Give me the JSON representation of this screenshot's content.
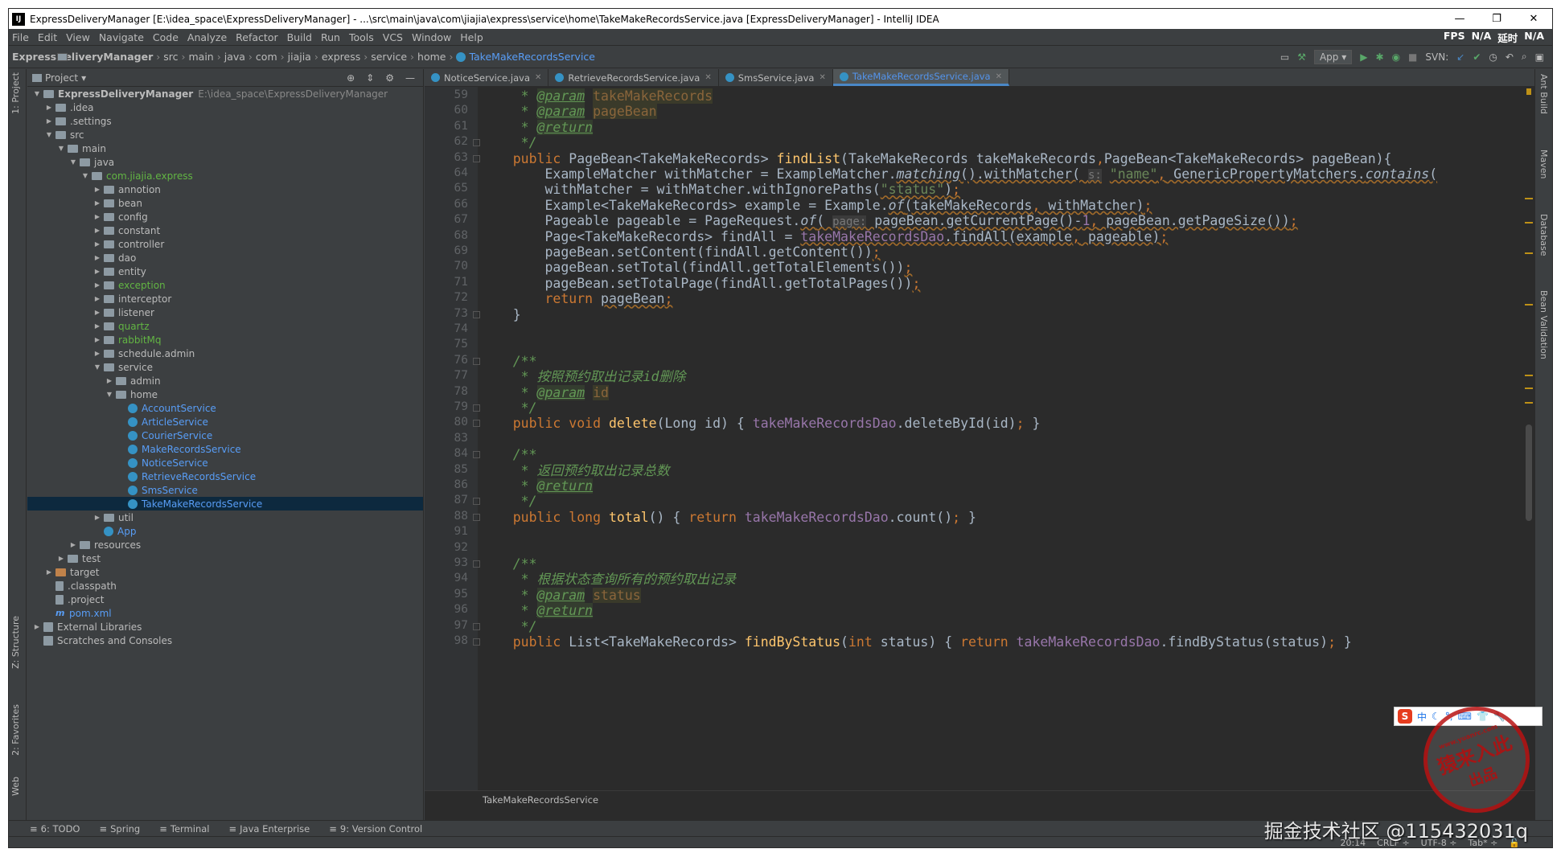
{
  "window": {
    "title": "ExpressDeliveryManager [E:\\idea_space\\ExpressDeliveryManager] - ...\\src\\main\\java\\com\\jiajia\\express\\service\\home\\TakeMakeRecordsService.java [ExpressDeliveryManager] - IntelliJ IDEA",
    "logo": "IJ",
    "minimize": "—",
    "restore": "❐",
    "close": "✕"
  },
  "menu": {
    "items": [
      "File",
      "Edit",
      "View",
      "Navigate",
      "Code",
      "Analyze",
      "Refactor",
      "Build",
      "Run",
      "Tools",
      "VCS",
      "Window",
      "Help"
    ],
    "fps_label": "FPS",
    "fps_value": "N/A",
    "latency_label": "延时",
    "latency_value": "N/A"
  },
  "breadcrumbs": [
    "ExpressDeliveryManager",
    "src",
    "main",
    "java",
    "com",
    "jiajia",
    "express",
    "service",
    "home",
    "TakeMakeRecordsService"
  ],
  "toolbar": {
    "run_config": "App",
    "svn_label": "SVN:"
  },
  "side_tabs": {
    "left": [
      "1: Project",
      "Z: Structure",
      "2: Favorites",
      "Web"
    ],
    "right": [
      "Ant Build",
      "Maven",
      "Database",
      "Bean Validation"
    ]
  },
  "project": {
    "title": "Project",
    "tree": [
      {
        "label": "ExpressDeliveryManager",
        "path": "E:\\idea_space\\ExpressDeliveryManager",
        "depth": 0,
        "arrow": "▼",
        "icon": "folder",
        "style": "bold"
      },
      {
        "label": ".idea",
        "depth": 1,
        "arrow": "▶",
        "icon": "folder"
      },
      {
        "label": ".settings",
        "depth": 1,
        "arrow": "▶",
        "icon": "folder"
      },
      {
        "label": "src",
        "depth": 1,
        "arrow": "▼",
        "icon": "folder"
      },
      {
        "label": "main",
        "depth": 2,
        "arrow": "▼",
        "icon": "folder"
      },
      {
        "label": "java",
        "depth": 3,
        "arrow": "▼",
        "icon": "folder"
      },
      {
        "label": "com.jiajia.express",
        "depth": 4,
        "arrow": "▼",
        "icon": "pkg",
        "style": "green"
      },
      {
        "label": "annotion",
        "depth": 5,
        "arrow": "▶",
        "icon": "pkg"
      },
      {
        "label": "bean",
        "depth": 5,
        "arrow": "▶",
        "icon": "pkg"
      },
      {
        "label": "config",
        "depth": 5,
        "arrow": "▶",
        "icon": "pkg"
      },
      {
        "label": "constant",
        "depth": 5,
        "arrow": "▶",
        "icon": "pkg"
      },
      {
        "label": "controller",
        "depth": 5,
        "arrow": "▶",
        "icon": "pkg"
      },
      {
        "label": "dao",
        "depth": 5,
        "arrow": "▶",
        "icon": "pkg"
      },
      {
        "label": "entity",
        "depth": 5,
        "arrow": "▶",
        "icon": "pkg"
      },
      {
        "label": "exception",
        "depth": 5,
        "arrow": "▶",
        "icon": "pkg",
        "style": "green"
      },
      {
        "label": "interceptor",
        "depth": 5,
        "arrow": "▶",
        "icon": "pkg"
      },
      {
        "label": "listener",
        "depth": 5,
        "arrow": "▶",
        "icon": "pkg"
      },
      {
        "label": "quartz",
        "depth": 5,
        "arrow": "▶",
        "icon": "pkg",
        "style": "green"
      },
      {
        "label": "rabbitMq",
        "depth": 5,
        "arrow": "▶",
        "icon": "pkg",
        "style": "green"
      },
      {
        "label": "schedule.admin",
        "depth": 5,
        "arrow": "▶",
        "icon": "pkg"
      },
      {
        "label": "service",
        "depth": 5,
        "arrow": "▼",
        "icon": "pkg"
      },
      {
        "label": "admin",
        "depth": 6,
        "arrow": "▶",
        "icon": "pkg"
      },
      {
        "label": "home",
        "depth": 6,
        "arrow": "▼",
        "icon": "pkg"
      },
      {
        "label": "AccountService",
        "depth": 7,
        "arrow": "",
        "icon": "class",
        "style": "blue"
      },
      {
        "label": "ArticleService",
        "depth": 7,
        "arrow": "",
        "icon": "class",
        "style": "blue"
      },
      {
        "label": "CourierService",
        "depth": 7,
        "arrow": "",
        "icon": "class",
        "style": "blue"
      },
      {
        "label": "MakeRecordsService",
        "depth": 7,
        "arrow": "",
        "icon": "class",
        "style": "blue"
      },
      {
        "label": "NoticeService",
        "depth": 7,
        "arrow": "",
        "icon": "class",
        "style": "blue"
      },
      {
        "label": "RetrieveRecordsService",
        "depth": 7,
        "arrow": "",
        "icon": "class",
        "style": "blue"
      },
      {
        "label": "SmsService",
        "depth": 7,
        "arrow": "",
        "icon": "class",
        "style": "blue"
      },
      {
        "label": "TakeMakeRecordsService",
        "depth": 7,
        "arrow": "",
        "icon": "class",
        "style": "blue",
        "selected": true
      },
      {
        "label": "util",
        "depth": 5,
        "arrow": "▶",
        "icon": "pkg"
      },
      {
        "label": "App",
        "depth": 5,
        "arrow": "",
        "icon": "class",
        "style": "blue"
      },
      {
        "label": "resources",
        "depth": 3,
        "arrow": "▶",
        "icon": "folder"
      },
      {
        "label": "test",
        "depth": 2,
        "arrow": "▶",
        "icon": "folder"
      },
      {
        "label": "target",
        "depth": 1,
        "arrow": "▶",
        "icon": "target"
      },
      {
        "label": ".classpath",
        "depth": 1,
        "arrow": "",
        "icon": "file"
      },
      {
        "label": ".project",
        "depth": 1,
        "arrow": "",
        "icon": "file"
      },
      {
        "label": "pom.xml",
        "depth": 1,
        "arrow": "",
        "icon": "maven",
        "style": "blue"
      },
      {
        "label": "External Libraries",
        "depth": 0,
        "arrow": "▶",
        "icon": "lib"
      },
      {
        "label": "Scratches and Consoles",
        "depth": 0,
        "arrow": "",
        "icon": "lib"
      }
    ]
  },
  "tabs": [
    {
      "label": "NoticeService.java",
      "active": false
    },
    {
      "label": "RetrieveRecordsService.java",
      "active": false
    },
    {
      "label": "SmsService.java",
      "active": false
    },
    {
      "label": "TakeMakeRecordsService.java",
      "active": true
    }
  ],
  "editor": {
    "line_numbers": [
      "59",
      "60",
      "61",
      "62",
      "63",
      "64",
      "65",
      "66",
      "67",
      "68",
      "69",
      "70",
      "71",
      "72",
      "73",
      "74",
      "75",
      "76",
      "77",
      "78",
      "79",
      "80",
      "83",
      "84",
      "85",
      "86",
      "87",
      "88",
      "91",
      "92",
      "93",
      "94",
      "95",
      "96",
      "97",
      "98"
    ],
    "lines": [
      [
        [
          "c",
          "     * "
        ],
        [
          "tagc",
          "@param"
        ],
        [
          "c",
          " "
        ],
        [
          "t",
          "takeMakeRecords"
        ]
      ],
      [
        [
          "c",
          "     * "
        ],
        [
          "tagc",
          "@param"
        ],
        [
          "c",
          " "
        ],
        [
          "t",
          "pageBean"
        ]
      ],
      [
        [
          "c",
          "     * "
        ],
        [
          "tagc",
          "@return"
        ]
      ],
      [
        [
          "c",
          "     */"
        ]
      ],
      [
        [
          "k",
          "    public "
        ],
        [
          "n",
          "PageBean<TakeMakeRecords> "
        ],
        [
          "f",
          "findList"
        ],
        [
          "n",
          "(TakeMakeRecords takeMakeRecords"
        ],
        [
          "k",
          ","
        ],
        [
          "n",
          "PageBean<TakeMakeRecords> pageBean){"
        ]
      ],
      [
        [
          "n",
          "        ExampleMatcher withMatcher = ExampleMatcher."
        ],
        [
          "ital",
          "matching"
        ],
        [
          "n",
          "().withMatcher( "
        ],
        [
          "hint",
          "s:"
        ],
        [
          "n",
          " "
        ],
        [
          "s",
          "\"name\""
        ],
        [
          "k",
          ","
        ],
        [
          "n",
          " GenericPropertyMatchers."
        ],
        [
          "ital",
          "contains"
        ],
        [
          "n",
          "("
        ]
      ],
      [
        [
          "n",
          "        withMatcher = withMatcher.withIgnorePaths("
        ],
        [
          "s",
          "\"status\""
        ],
        [
          "n",
          ")"
        ],
        [
          "k",
          ";"
        ]
      ],
      [
        [
          "n",
          "        Example<TakeMakeRecords> example = Example."
        ],
        [
          "ital",
          "of"
        ],
        [
          "n",
          "(takeMakeRecords"
        ],
        [
          "k",
          ","
        ],
        [
          "n",
          " withMatcher)"
        ],
        [
          "k",
          ";"
        ]
      ],
      [
        [
          "n",
          "        Pageable pageable = PageRequest."
        ],
        [
          "ital",
          "of"
        ],
        [
          "n",
          "( "
        ],
        [
          "hint",
          "page:"
        ],
        [
          "n",
          " pageBean.getCurrentPage()-"
        ],
        [
          "p",
          "1"
        ],
        [
          "k",
          ","
        ],
        [
          "n",
          " pageBean.getPageSize())"
        ],
        [
          "k",
          ";"
        ]
      ],
      [
        [
          "n",
          "        Page<TakeMakeRecords> findAll = "
        ],
        [
          "p",
          "takeMakeRecordsDao"
        ],
        [
          "n",
          ".findAll(example"
        ],
        [
          "k",
          ","
        ],
        [
          "n",
          " pageable)"
        ],
        [
          "k",
          ";"
        ]
      ],
      [
        [
          "n",
          "        pageBean.setContent(findAll.getContent())"
        ],
        [
          "k",
          ";"
        ]
      ],
      [
        [
          "n",
          "        pageBean.setTotal(findAll.getTotalElements())"
        ],
        [
          "k",
          ";"
        ]
      ],
      [
        [
          "n",
          "        pageBean.setTotalPage(findAll.getTotalPages())"
        ],
        [
          "k",
          ";"
        ]
      ],
      [
        [
          "k",
          "        return "
        ],
        [
          "n",
          "pageBean"
        ],
        [
          "k",
          ";"
        ]
      ],
      [
        [
          "n",
          "    }"
        ]
      ],
      [
        [
          "n",
          ""
        ]
      ],
      [
        [
          "n",
          ""
        ]
      ],
      [
        [
          "c",
          "    /**"
        ]
      ],
      [
        [
          "c",
          "     * 按照预约取出记录id删除"
        ]
      ],
      [
        [
          "c",
          "     * "
        ],
        [
          "tagc",
          "@param"
        ],
        [
          "c",
          " "
        ],
        [
          "t",
          "id"
        ]
      ],
      [
        [
          "c",
          "     */"
        ]
      ],
      [
        [
          "k",
          "    public void "
        ],
        [
          "f",
          "delete"
        ],
        [
          "n",
          "(Long id) { "
        ],
        [
          "p",
          "takeMakeRecordsDao"
        ],
        [
          "n",
          ".deleteById(id)"
        ],
        [
          "k",
          ";"
        ],
        [
          "n",
          " }"
        ]
      ],
      [
        [
          "n",
          ""
        ]
      ],
      [
        [
          "c",
          "    /**"
        ]
      ],
      [
        [
          "c",
          "     * 返回预约取出记录总数"
        ]
      ],
      [
        [
          "c",
          "     * "
        ],
        [
          "tagc",
          "@return"
        ]
      ],
      [
        [
          "c",
          "     */"
        ]
      ],
      [
        [
          "k",
          "    public long "
        ],
        [
          "f",
          "total"
        ],
        [
          "n",
          "() { "
        ],
        [
          "k",
          "return "
        ],
        [
          "p",
          "takeMakeRecordsDao"
        ],
        [
          "n",
          ".count()"
        ],
        [
          "k",
          ";"
        ],
        [
          "n",
          " }"
        ]
      ],
      [
        [
          "n",
          ""
        ]
      ],
      [
        [
          "n",
          ""
        ]
      ],
      [
        [
          "c",
          "    /**"
        ]
      ],
      [
        [
          "c",
          "     * 根据状态查询所有的预约取出记录"
        ]
      ],
      [
        [
          "c",
          "     * "
        ],
        [
          "tagc",
          "@param"
        ],
        [
          "c",
          " "
        ],
        [
          "t",
          "status"
        ]
      ],
      [
        [
          "c",
          "     * "
        ],
        [
          "tagc",
          "@return"
        ]
      ],
      [
        [
          "c",
          "     */"
        ]
      ],
      [
        [
          "k",
          "    public "
        ],
        [
          "n",
          "List<TakeMakeRecords> "
        ],
        [
          "f",
          "findByStatus"
        ],
        [
          "n",
          "("
        ],
        [
          "k",
          "int "
        ],
        [
          "n",
          "status) { "
        ],
        [
          "k",
          "return "
        ],
        [
          "p",
          "takeMakeRecordsDao"
        ],
        [
          "n",
          ".findByStatus(status)"
        ],
        [
          "k",
          ";"
        ],
        [
          "n",
          " }"
        ]
      ]
    ],
    "breadcrumb_bottom": "TakeMakeRecordsService"
  },
  "bottom_tools": [
    {
      "label": "6: TODO",
      "icon": "todo-icon"
    },
    {
      "label": "Spring",
      "icon": "spring-icon"
    },
    {
      "label": "Terminal",
      "icon": "terminal-icon"
    },
    {
      "label": "Java Enterprise",
      "icon": "java-enterprise-icon"
    },
    {
      "label": "9: Version Control",
      "icon": "vcs-icon"
    }
  ],
  "status": {
    "position": "20:14",
    "line_sep": "CRLF ÷",
    "encoding": "UTF-8 ÷",
    "indent": "Tab* ÷"
  },
  "watermark": "掘金技术社区 @115432031q",
  "ime": {
    "lang": "中"
  },
  "stamp": {
    "line1": "猿来入此",
    "line2": "出品",
    "url": "www.yuanrc.com"
  }
}
